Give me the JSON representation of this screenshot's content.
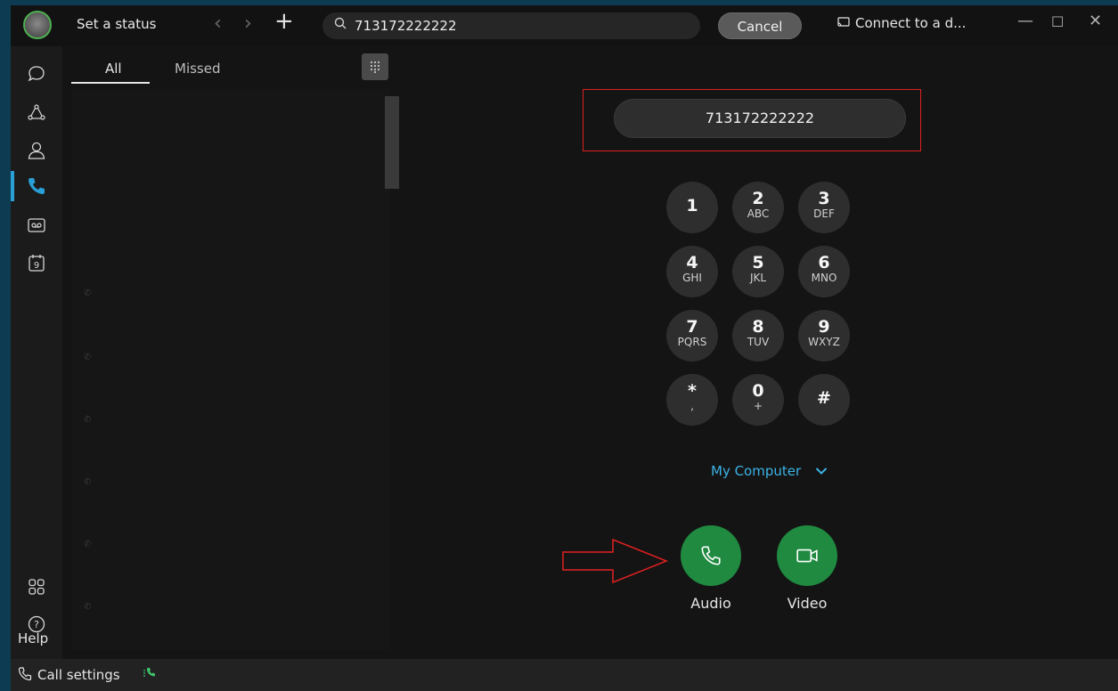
{
  "titlebar": {
    "status_label": "Set a status",
    "search_value": "713172222222",
    "cancel_label": "Cancel",
    "connect_label": "Connect to a d..."
  },
  "rail": {
    "help_label": "Help"
  },
  "calls": {
    "tabs": [
      {
        "label": "All",
        "active": true
      },
      {
        "label": "Missed",
        "active": false
      }
    ]
  },
  "dialer": {
    "number": "713172222222",
    "keys": [
      {
        "digit": "1",
        "letters": ""
      },
      {
        "digit": "2",
        "letters": "ABC"
      },
      {
        "digit": "3",
        "letters": "DEF"
      },
      {
        "digit": "4",
        "letters": "GHI"
      },
      {
        "digit": "5",
        "letters": "JKL"
      },
      {
        "digit": "6",
        "letters": "MNO"
      },
      {
        "digit": "7",
        "letters": "PQRS"
      },
      {
        "digit": "8",
        "letters": "TUV"
      },
      {
        "digit": "9",
        "letters": "WXYZ"
      },
      {
        "digit": "*",
        "letters": ","
      },
      {
        "digit": "0",
        "letters": "+"
      },
      {
        "digit": "#",
        "letters": ""
      }
    ],
    "device_label": "My Computer",
    "audio_label": "Audio",
    "video_label": "Video"
  },
  "statusbar": {
    "call_settings_label": "Call settings"
  },
  "colors": {
    "accent_blue": "#3bb3e6",
    "call_green": "#1f8a40",
    "highlight_red": "#e02020"
  }
}
